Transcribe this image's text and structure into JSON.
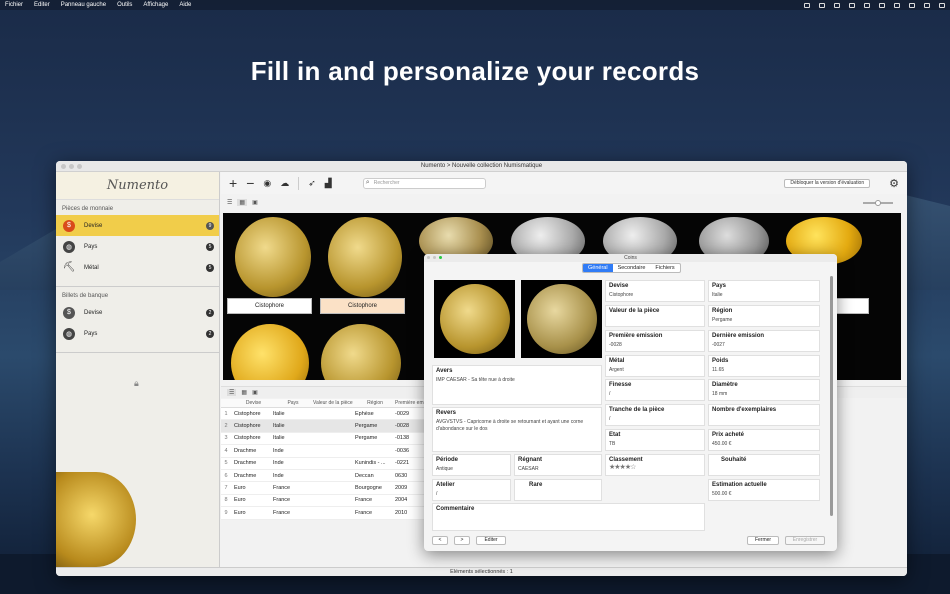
{
  "menubar": {
    "items": [
      "Fichier",
      "Editer",
      "Panneau gauche",
      "Outils",
      "Affichage",
      "Aide"
    ]
  },
  "headline": "Fill in and personalize your records",
  "window": {
    "title": "Numento > Nouvelle collection Numismatique"
  },
  "sidebar": {
    "logo": "Numento",
    "section1": "Pièces de monnaie",
    "items1": [
      {
        "label": "Devise",
        "count": "9"
      },
      {
        "label": "Pays",
        "count": "5"
      },
      {
        "label": "Métal",
        "count": "5"
      }
    ],
    "section2": "Billets de banque",
    "items2": [
      {
        "label": "Devise",
        "count": "2"
      },
      {
        "label": "Pays",
        "count": "2"
      }
    ]
  },
  "toolbar": {
    "search_placeholder": "Rechercher",
    "trial": "Débloquer la version d'évaluation"
  },
  "gallery": {
    "labels": [
      "Cistophore",
      "Cistophore"
    ]
  },
  "table": {
    "headers": [
      "Devise",
      "Pays",
      "Valeur de la pièce",
      "Région",
      "Première em"
    ],
    "rows": [
      [
        "1",
        "Cistophore",
        "Italie",
        "",
        "Ephèse",
        "-0029"
      ],
      [
        "2",
        "Cistophore",
        "Italie",
        "",
        "Pergame",
        "-0028"
      ],
      [
        "3",
        "Cistophore",
        "Italie",
        "",
        "Pergame",
        "-0138"
      ],
      [
        "4",
        "Drachme",
        "Inde",
        "",
        "",
        "-0036"
      ],
      [
        "5",
        "Drachme",
        "Inde",
        "",
        "Kunindis - ...",
        "-0221"
      ],
      [
        "6",
        "Drachme",
        "Inde",
        "",
        "Deccan",
        "0630"
      ],
      [
        "7",
        "Euro",
        "France",
        "",
        "Bourgogne",
        "2009"
      ],
      [
        "8",
        "Euro",
        "France",
        "",
        "France",
        "2004"
      ],
      [
        "9",
        "Euro",
        "France",
        "",
        "France",
        "2010"
      ]
    ]
  },
  "status": "Eléments sélectionnés : 1",
  "dialog": {
    "title": "Coins",
    "tabs": [
      "Général",
      "Secondaire",
      "Fichiers"
    ],
    "avers": {
      "label": "Avers",
      "value": "IMP CAESAR - Sa tête nue à droite"
    },
    "revers": {
      "label": "Revers",
      "value": "AVGVSTVS - Capricorne à droite se retournant et ayant une corne d'abondance sur le dos"
    },
    "periode": {
      "label": "Période",
      "value": "Antique"
    },
    "regnant": {
      "label": "Régnant",
      "value": "CAESAR"
    },
    "atelier": {
      "label": "Atelier",
      "value": "/"
    },
    "rare": {
      "label": "Rare"
    },
    "commentaire": {
      "label": "Commentaire"
    },
    "devise": {
      "label": "Devise",
      "value": "Cistophore"
    },
    "pays": {
      "label": "Pays",
      "value": "Italie"
    },
    "valeur": {
      "label": "Valeur de la pièce",
      "value": ""
    },
    "region": {
      "label": "Région",
      "value": "Pergame"
    },
    "premiere": {
      "label": "Première emission",
      "value": "-0028"
    },
    "derniere": {
      "label": "Dernière emission",
      "value": "-0027"
    },
    "metal": {
      "label": "Métal",
      "value": "Argent"
    },
    "poids": {
      "label": "Poids",
      "value": "11.65"
    },
    "finesse": {
      "label": "Finesse",
      "value": "/"
    },
    "diametre": {
      "label": "Diamètre",
      "value": "18 mm"
    },
    "tranche": {
      "label": "Tranche de la pièce",
      "value": "/"
    },
    "nombre": {
      "label": "Nombre d'exemplaires",
      "value": ""
    },
    "etat": {
      "label": "Etat",
      "value": "TB"
    },
    "prix": {
      "label": "Prix acheté",
      "value": "450.00 €"
    },
    "classement": {
      "label": "Classement",
      "value": "★★★★☆"
    },
    "souhaite": {
      "label": "Souhaité"
    },
    "estimation": {
      "label": "Estimation actuelle",
      "value": "500.00 €"
    },
    "buttons": {
      "prev": "<",
      "next": ">",
      "edit": "Editer",
      "close": "Fermer",
      "save": "Enregistrer"
    }
  }
}
